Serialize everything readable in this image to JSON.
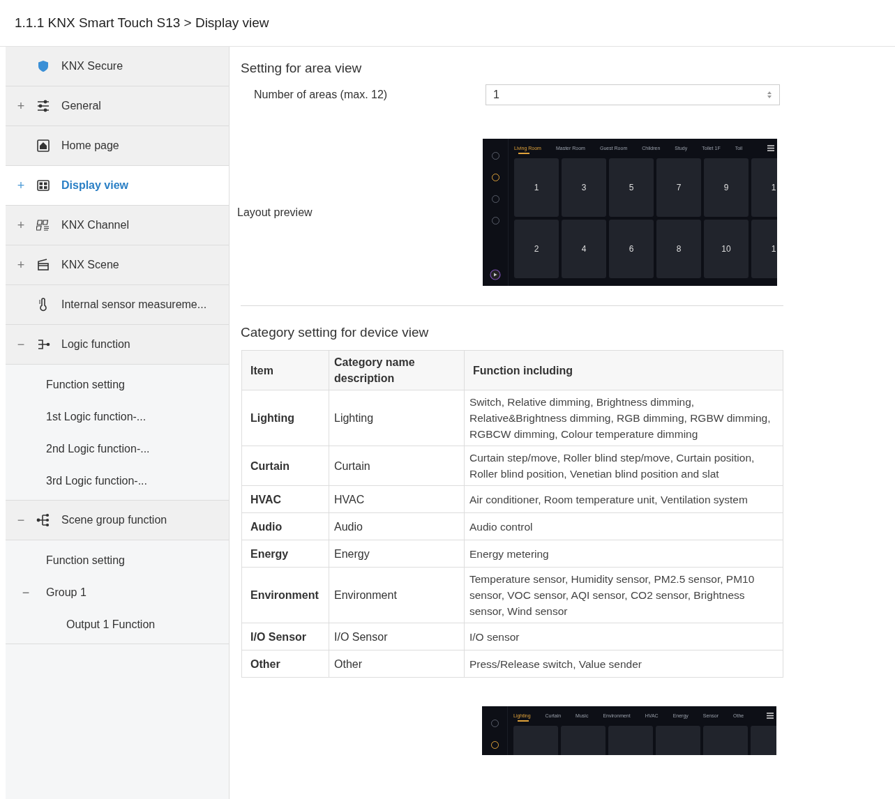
{
  "header": {
    "title": "1.1.1 KNX Smart Touch S13 > Display view"
  },
  "sidebar": {
    "items": [
      {
        "label": "KNX Secure",
        "kind": "shield",
        "selected": false
      },
      {
        "label": "General",
        "kind": "sliders",
        "toggle": "+",
        "selected": false
      },
      {
        "label": "Home page",
        "kind": "home",
        "selected": false
      },
      {
        "label": "Display view",
        "kind": "grid",
        "toggle": "+",
        "selected": true
      },
      {
        "label": "KNX Channel",
        "kind": "channel",
        "toggle": "+",
        "selected": false
      },
      {
        "label": "KNX Scene",
        "kind": "clapper",
        "toggle": "+",
        "selected": false
      },
      {
        "label": "Internal sensor measureme...",
        "kind": "thermometer",
        "selected": false
      },
      {
        "label": "Logic function",
        "kind": "logic",
        "toggle": "−",
        "selected": false,
        "children": [
          {
            "label": "Function setting"
          },
          {
            "label": "1st Logic function-..."
          },
          {
            "label": "2nd Logic function-..."
          },
          {
            "label": "3rd Logic function-..."
          }
        ]
      },
      {
        "label": "Scene group function",
        "kind": "tree",
        "toggle": "−",
        "selected": false,
        "children": [
          {
            "label": "Function setting"
          },
          {
            "label": "Group 1",
            "toggle": "−",
            "children": [
              {
                "label": "Output 1 Function"
              }
            ]
          }
        ]
      }
    ]
  },
  "area_section": {
    "heading": "Setting for area view",
    "number_label": "Number of areas (max. 12)",
    "number_value": "1",
    "preview_label": "Layout preview",
    "preview": {
      "tabs": [
        {
          "label": "Living Room",
          "selected": true
        },
        {
          "label": "Master Room",
          "selected": false
        },
        {
          "label": "Guest Room",
          "selected": false
        },
        {
          "label": "Children",
          "selected": false
        },
        {
          "label": "Study",
          "selected": false
        },
        {
          "label": "Toilet 1F",
          "selected": false
        },
        {
          "label": "Toil",
          "selected": false
        }
      ],
      "rail": [
        {
          "selected": false
        },
        {
          "selected": true
        },
        {
          "selected": false
        },
        {
          "selected": false
        }
      ],
      "tiles": [
        "1",
        "3",
        "5",
        "7",
        "9",
        "1",
        "2",
        "4",
        "6",
        "8",
        "10",
        "1"
      ]
    }
  },
  "category_section": {
    "heading": "Category setting for device view",
    "columns": [
      "Item",
      "Category name description",
      "Function including"
    ],
    "rows": [
      {
        "item": "Lighting",
        "name": "Lighting",
        "functions": "Switch, Relative dimming, Brightness dimming, Relative&Brightness dimming, RGB dimming, RGBW dimming, RGBCW dimming, Colour temperature dimming"
      },
      {
        "item": "Curtain",
        "name": "Curtain",
        "functions": "Curtain step/move, Roller blind step/move, Curtain position, Roller blind position, Venetian blind position and slat"
      },
      {
        "item": "HVAC",
        "name": "HVAC",
        "functions": "Air conditioner, Room temperature unit, Ventilation system"
      },
      {
        "item": "Audio",
        "name": "Audio",
        "functions": "Audio control"
      },
      {
        "item": "Energy",
        "name": "Energy",
        "functions": "Energy metering"
      },
      {
        "item": "Environment",
        "name": "Environment",
        "functions": "Temperature sensor, Humidity sensor, PM2.5 sensor, PM10 sensor, VOC sensor, AQI sensor, CO2 sensor, Brightness sensor, Wind sensor"
      },
      {
        "item": "I/O Sensor",
        "name": "I/O Sensor",
        "functions": "I/O sensor"
      },
      {
        "item": "Other",
        "name": "Other",
        "functions": "Press/Release switch, Value sender"
      }
    ],
    "preview": {
      "tabs": [
        {
          "label": "Lighting",
          "selected": true
        },
        {
          "label": "Curtain",
          "selected": false
        },
        {
          "label": "Music",
          "selected": false
        },
        {
          "label": "Environment",
          "selected": false
        },
        {
          "label": "HVAC",
          "selected": false
        },
        {
          "label": "Energy",
          "selected": false
        },
        {
          "label": "Sensor",
          "selected": false
        },
        {
          "label": "Othe",
          "selected": false
        }
      ],
      "rail": [
        {
          "selected": false
        },
        {
          "selected": true
        }
      ]
    }
  }
}
